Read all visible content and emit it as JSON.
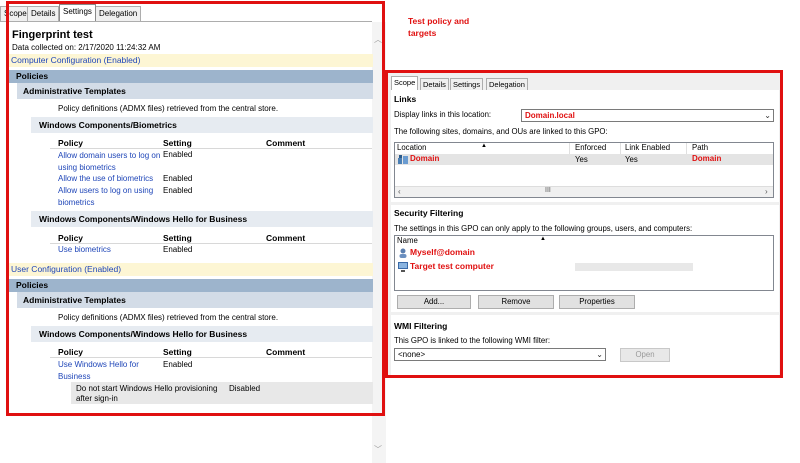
{
  "left": {
    "tabs": [
      "Scope",
      "Details",
      "Settings",
      "Delegation"
    ],
    "report_title": "Fingerprint test",
    "data_collected": "Data collected on: 2/17/2020 11:24:32 AM",
    "computer_config": "Computer Configuration (Enabled)",
    "user_config": "User Configuration (Enabled)",
    "policies": "Policies",
    "admin_templates": "Administrative Templates",
    "admx_note": "Policy definitions (ADMX files) retrieved from the central store.",
    "biometrics_section": "Windows Components/Biometrics",
    "hello_section": "Windows Components/Windows Hello for Business",
    "col_policy": "Policy",
    "col_setting": "Setting",
    "col_comment": "Comment",
    "computer_biometrics_rows": [
      {
        "policy_l1": "Allow domain users to log on",
        "policy_l2": "using biometrics",
        "setting": "Enabled"
      },
      {
        "policy_l1": "Allow the use of biometrics",
        "policy_l2": "",
        "setting": "Enabled"
      },
      {
        "policy_l1": "Allow users to log on using",
        "policy_l2": "biometrics",
        "setting": "Enabled"
      }
    ],
    "computer_hello_rows": [
      {
        "policy": "Use biometrics",
        "setting": "Enabled"
      }
    ],
    "user_hello_rows": [
      {
        "policy_l1": "Use Windows Hello for",
        "policy_l2": "Business",
        "setting": "Enabled"
      }
    ],
    "user_hello_sub": {
      "label_l1": "Do not start Windows Hello provisioning",
      "label_l2": "after sign-in",
      "setting": "Disabled"
    }
  },
  "annotation": "Test policy and\ntargets",
  "right": {
    "tabs": [
      "Scope",
      "Details",
      "Settings",
      "Delegation"
    ],
    "links_title": "Links",
    "display_links_label": "Display links in this location:",
    "display_links_value": "Domain.local",
    "linked_note": "The following sites, domains, and OUs are linked to this GPO:",
    "links_columns": [
      "Location",
      "Enforced",
      "Link Enabled",
      "Path"
    ],
    "links_rows": [
      {
        "location": "Domain",
        "enforced": "Yes",
        "link_enabled": "Yes",
        "path": "Domain"
      }
    ],
    "scroll_thumb": "III",
    "security_title": "Security Filtering",
    "security_note": "The settings in this GPO can only apply to the following groups, users, and computers:",
    "security_column": "Name",
    "security_rows": [
      "Myself@domain",
      "Target test computer"
    ],
    "buttons": {
      "add": "Add...",
      "remove": "Remove",
      "properties": "Properties"
    },
    "wmi_title": "WMI Filtering",
    "wmi_note": "This GPO is linked to the following WMI filter:",
    "wmi_value": "<none>",
    "open_button": "Open"
  },
  "colors": {
    "annotation_red": "#e01010",
    "link_blue": "#1f46b8",
    "band_dark": "#9db4cc",
    "band_mid": "#d3dce7",
    "band_light": "#e6ebf1",
    "config_bar": "#fdf6d4"
  }
}
